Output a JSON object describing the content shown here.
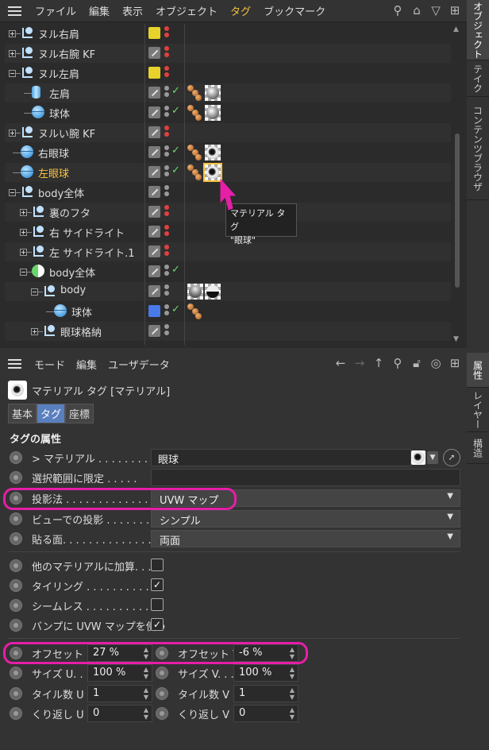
{
  "object_manager": {
    "menu": [
      "ファイル",
      "編集",
      "表示",
      "オブジェクト",
      "タグ",
      "ブックマーク"
    ],
    "active_menu_index": 4,
    "rows": [
      {
        "name": "ヌル右肩",
        "icon": "null",
        "color": "#e6d22a"
      },
      {
        "name": "ヌル右腕 KF",
        "icon": "null"
      },
      {
        "name": "ヌル左肩",
        "icon": "null",
        "color": "#e6d22a"
      },
      {
        "name": "左肩",
        "icon": "cylinder"
      },
      {
        "name": "球体",
        "icon": "sphere"
      },
      {
        "name": "ヌルい腕 KF",
        "icon": "null"
      },
      {
        "name": "右眼球",
        "icon": "sphere"
      },
      {
        "name": "左眼球",
        "icon": "sphere",
        "selected": true
      },
      {
        "name": "body全体",
        "icon": "null"
      },
      {
        "name": "裏のフタ",
        "icon": "null"
      },
      {
        "name": "右 サイドライト",
        "icon": "null"
      },
      {
        "name": "左 サイドライト.1",
        "icon": "null"
      },
      {
        "name": "body全体",
        "icon": "mixed"
      },
      {
        "name": "body",
        "icon": "null"
      },
      {
        "name": "球体",
        "icon": "sphere",
        "color": "#4a7ae8"
      },
      {
        "name": "眼球格納",
        "icon": "null"
      }
    ],
    "tooltip": {
      "line1": "マテリアル タグ",
      "line2": "\"眼球\""
    }
  },
  "side_tabs_top": [
    "オブジェクト",
    "テイク",
    "コンテンツブラウザ"
  ],
  "side_tabs_bottom": [
    "属性",
    "レイヤー",
    "構造"
  ],
  "attributes": {
    "menu": [
      "モード",
      "編集",
      "ユーザデータ"
    ],
    "title": "マテリアル タグ [マテリアル]",
    "tabs": [
      "基本",
      "タグ",
      "座標"
    ],
    "active_tab_index": 1,
    "section": "タグの属性",
    "material_label": "マテリアル . . . . . . . . . .",
    "material_value": "眼球",
    "restrict_label": "選択範囲に限定 . . . . .",
    "restrict_value": "",
    "projection_label": "投影法 . . . . . . . . . . . . . .",
    "projection_value": "UVW マップ",
    "viewport_label": "ビューでの投影 . . . . . . . .",
    "viewport_value": "シンプル",
    "side_label": "貼る面. . . . . . . . . . . . . . .",
    "side_value": "両面",
    "add_label": "他のマテリアルに加算. . . .",
    "add_checked": false,
    "tiling_label": "タイリング . . . . . . . . . . . .",
    "tiling_checked": true,
    "seamless_label": "シームレス . . . . . . . . . . . .",
    "seamless_checked": false,
    "bump_label": "バンプに UVW マップを使う",
    "bump_checked": true,
    "offset_u_label": "オフセット U",
    "offset_u_value": "27 %",
    "offset_v_label": "オフセット V",
    "offset_v_value": "-6 %",
    "size_u_label": "サイズ U. . .",
    "size_u_value": "100 %",
    "size_v_label": "サイズ V. . .",
    "size_v_value": "100 %",
    "tiles_u_label": "タイル数 U",
    "tiles_u_value": "1",
    "tiles_v_label": "タイル数 V",
    "tiles_v_value": "1",
    "repeat_u_label": "くり返し U",
    "repeat_u_value": "0",
    "repeat_v_label": "くり返し V",
    "repeat_v_value": "0"
  },
  "colors": {
    "accent": "#f6c23e",
    "highlight": "#e61ea8",
    "active_tab": "#5a7fbf"
  }
}
